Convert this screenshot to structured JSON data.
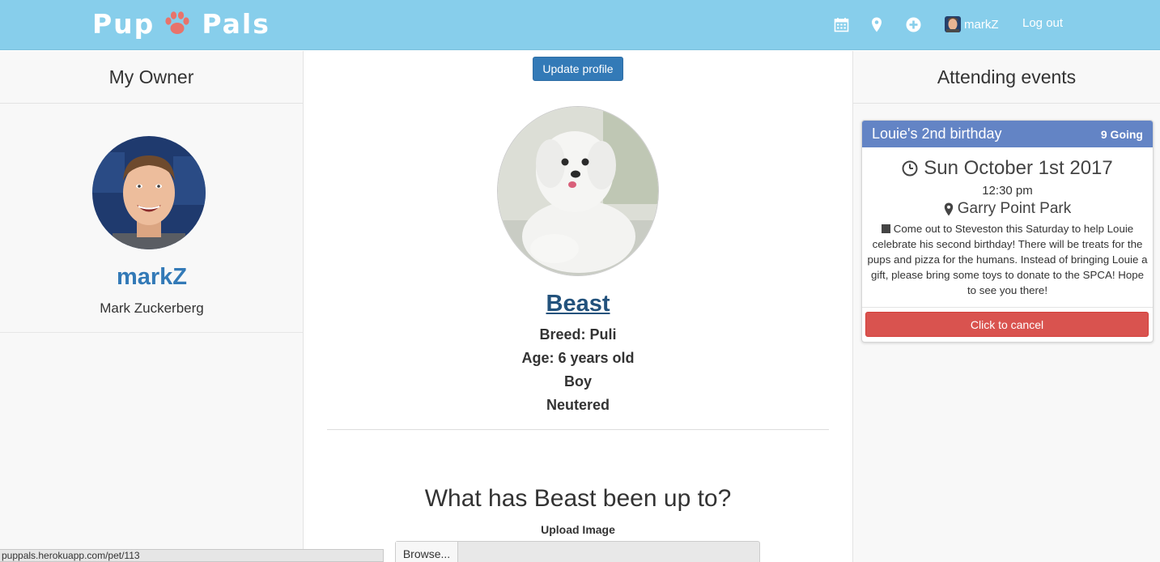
{
  "navbar": {
    "brand_left": "Pup",
    "brand_right": "Pals",
    "icons": [
      "calendar-icon",
      "map-marker-icon",
      "plus-circle-icon"
    ],
    "username": "markZ",
    "logout_label": "Log out",
    "background_color": "#87ceeb",
    "paw_color": "#e8736b"
  },
  "owner": {
    "header": "My Owner",
    "username": "markZ",
    "full_name": "Mark Zuckerberg"
  },
  "pet": {
    "update_label": "Update profile",
    "name": "Beast",
    "breed": "Breed: Puli",
    "age": "Age: 6 years old",
    "gender": "Boy",
    "status": "Neutered",
    "activity_title": "What has Beast been up to?",
    "upload_label": "Upload Image",
    "browse_label": "Browse..."
  },
  "events": {
    "header": "Attending events",
    "items": [
      {
        "title": "Louie's 2nd birthday",
        "going": "9 Going",
        "date": "Sun October 1st 2017",
        "time": "12:30 pm",
        "location": "Garry Point Park",
        "description": "Come out to Steveston this Saturday to help Louie celebrate his second birthday! There will be treats for the pups and pizza for the humans. Instead of bringing Louie a gift, please bring some toys to donate to the SPCA! Hope to see you there!",
        "cancel_label": "Click to cancel",
        "header_color": "#6384c5",
        "cancel_color": "#d9534f"
      }
    ]
  },
  "status_bar": {
    "url": "puppals.herokuapp.com/pet/113"
  }
}
